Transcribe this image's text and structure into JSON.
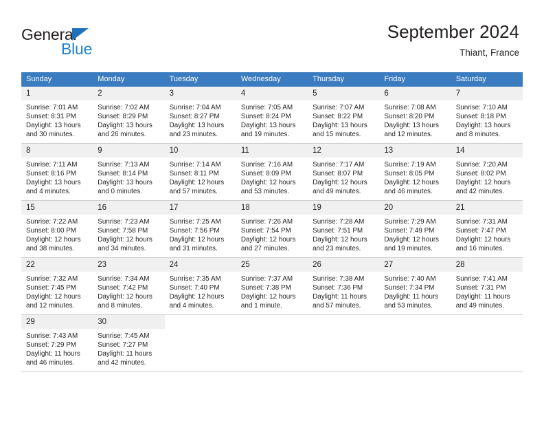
{
  "brand": {
    "name_dark": "General",
    "name_blue": "Blue",
    "accent_blue": "#2083c9",
    "triangle_blue": "#1d72bb"
  },
  "header": {
    "title": "September 2024",
    "subtitle": "Thiant, France",
    "header_bg": "#3b7cc0",
    "daynum_bg": "#f0f0f0"
  },
  "weekday_headers": [
    "Sunday",
    "Monday",
    "Tuesday",
    "Wednesday",
    "Thursday",
    "Friday",
    "Saturday"
  ],
  "weeks": [
    [
      {
        "day": "1",
        "sunrise": "Sunrise: 7:01 AM",
        "sunset": "Sunset: 8:31 PM",
        "daylight_1": "Daylight: 13 hours",
        "daylight_2": "and 30 minutes."
      },
      {
        "day": "2",
        "sunrise": "Sunrise: 7:02 AM",
        "sunset": "Sunset: 8:29 PM",
        "daylight_1": "Daylight: 13 hours",
        "daylight_2": "and 26 minutes."
      },
      {
        "day": "3",
        "sunrise": "Sunrise: 7:04 AM",
        "sunset": "Sunset: 8:27 PM",
        "daylight_1": "Daylight: 13 hours",
        "daylight_2": "and 23 minutes."
      },
      {
        "day": "4",
        "sunrise": "Sunrise: 7:05 AM",
        "sunset": "Sunset: 8:24 PM",
        "daylight_1": "Daylight: 13 hours",
        "daylight_2": "and 19 minutes."
      },
      {
        "day": "5",
        "sunrise": "Sunrise: 7:07 AM",
        "sunset": "Sunset: 8:22 PM",
        "daylight_1": "Daylight: 13 hours",
        "daylight_2": "and 15 minutes."
      },
      {
        "day": "6",
        "sunrise": "Sunrise: 7:08 AM",
        "sunset": "Sunset: 8:20 PM",
        "daylight_1": "Daylight: 13 hours",
        "daylight_2": "and 12 minutes."
      },
      {
        "day": "7",
        "sunrise": "Sunrise: 7:10 AM",
        "sunset": "Sunset: 8:18 PM",
        "daylight_1": "Daylight: 13 hours",
        "daylight_2": "and 8 minutes."
      }
    ],
    [
      {
        "day": "8",
        "sunrise": "Sunrise: 7:11 AM",
        "sunset": "Sunset: 8:16 PM",
        "daylight_1": "Daylight: 13 hours",
        "daylight_2": "and 4 minutes."
      },
      {
        "day": "9",
        "sunrise": "Sunrise: 7:13 AM",
        "sunset": "Sunset: 8:14 PM",
        "daylight_1": "Daylight: 13 hours",
        "daylight_2": "and 0 minutes."
      },
      {
        "day": "10",
        "sunrise": "Sunrise: 7:14 AM",
        "sunset": "Sunset: 8:11 PM",
        "daylight_1": "Daylight: 12 hours",
        "daylight_2": "and 57 minutes."
      },
      {
        "day": "11",
        "sunrise": "Sunrise: 7:16 AM",
        "sunset": "Sunset: 8:09 PM",
        "daylight_1": "Daylight: 12 hours",
        "daylight_2": "and 53 minutes."
      },
      {
        "day": "12",
        "sunrise": "Sunrise: 7:17 AM",
        "sunset": "Sunset: 8:07 PM",
        "daylight_1": "Daylight: 12 hours",
        "daylight_2": "and 49 minutes."
      },
      {
        "day": "13",
        "sunrise": "Sunrise: 7:19 AM",
        "sunset": "Sunset: 8:05 PM",
        "daylight_1": "Daylight: 12 hours",
        "daylight_2": "and 46 minutes."
      },
      {
        "day": "14",
        "sunrise": "Sunrise: 7:20 AM",
        "sunset": "Sunset: 8:02 PM",
        "daylight_1": "Daylight: 12 hours",
        "daylight_2": "and 42 minutes."
      }
    ],
    [
      {
        "day": "15",
        "sunrise": "Sunrise: 7:22 AM",
        "sunset": "Sunset: 8:00 PM",
        "daylight_1": "Daylight: 12 hours",
        "daylight_2": "and 38 minutes."
      },
      {
        "day": "16",
        "sunrise": "Sunrise: 7:23 AM",
        "sunset": "Sunset: 7:58 PM",
        "daylight_1": "Daylight: 12 hours",
        "daylight_2": "and 34 minutes."
      },
      {
        "day": "17",
        "sunrise": "Sunrise: 7:25 AM",
        "sunset": "Sunset: 7:56 PM",
        "daylight_1": "Daylight: 12 hours",
        "daylight_2": "and 31 minutes."
      },
      {
        "day": "18",
        "sunrise": "Sunrise: 7:26 AM",
        "sunset": "Sunset: 7:54 PM",
        "daylight_1": "Daylight: 12 hours",
        "daylight_2": "and 27 minutes."
      },
      {
        "day": "19",
        "sunrise": "Sunrise: 7:28 AM",
        "sunset": "Sunset: 7:51 PM",
        "daylight_1": "Daylight: 12 hours",
        "daylight_2": "and 23 minutes."
      },
      {
        "day": "20",
        "sunrise": "Sunrise: 7:29 AM",
        "sunset": "Sunset: 7:49 PM",
        "daylight_1": "Daylight: 12 hours",
        "daylight_2": "and 19 minutes."
      },
      {
        "day": "21",
        "sunrise": "Sunrise: 7:31 AM",
        "sunset": "Sunset: 7:47 PM",
        "daylight_1": "Daylight: 12 hours",
        "daylight_2": "and 16 minutes."
      }
    ],
    [
      {
        "day": "22",
        "sunrise": "Sunrise: 7:32 AM",
        "sunset": "Sunset: 7:45 PM",
        "daylight_1": "Daylight: 12 hours",
        "daylight_2": "and 12 minutes."
      },
      {
        "day": "23",
        "sunrise": "Sunrise: 7:34 AM",
        "sunset": "Sunset: 7:42 PM",
        "daylight_1": "Daylight: 12 hours",
        "daylight_2": "and 8 minutes."
      },
      {
        "day": "24",
        "sunrise": "Sunrise: 7:35 AM",
        "sunset": "Sunset: 7:40 PM",
        "daylight_1": "Daylight: 12 hours",
        "daylight_2": "and 4 minutes."
      },
      {
        "day": "25",
        "sunrise": "Sunrise: 7:37 AM",
        "sunset": "Sunset: 7:38 PM",
        "daylight_1": "Daylight: 12 hours",
        "daylight_2": "and 1 minute."
      },
      {
        "day": "26",
        "sunrise": "Sunrise: 7:38 AM",
        "sunset": "Sunset: 7:36 PM",
        "daylight_1": "Daylight: 11 hours",
        "daylight_2": "and 57 minutes."
      },
      {
        "day": "27",
        "sunrise": "Sunrise: 7:40 AM",
        "sunset": "Sunset: 7:34 PM",
        "daylight_1": "Daylight: 11 hours",
        "daylight_2": "and 53 minutes."
      },
      {
        "day": "28",
        "sunrise": "Sunrise: 7:41 AM",
        "sunset": "Sunset: 7:31 PM",
        "daylight_1": "Daylight: 11 hours",
        "daylight_2": "and 49 minutes."
      }
    ],
    [
      {
        "day": "29",
        "sunrise": "Sunrise: 7:43 AM",
        "sunset": "Sunset: 7:29 PM",
        "daylight_1": "Daylight: 11 hours",
        "daylight_2": "and 46 minutes."
      },
      {
        "day": "30",
        "sunrise": "Sunrise: 7:45 AM",
        "sunset": "Sunset: 7:27 PM",
        "daylight_1": "Daylight: 11 hours",
        "daylight_2": "and 42 minutes."
      },
      {
        "day": "",
        "sunrise": "",
        "sunset": "",
        "daylight_1": "",
        "daylight_2": ""
      },
      {
        "day": "",
        "sunrise": "",
        "sunset": "",
        "daylight_1": "",
        "daylight_2": ""
      },
      {
        "day": "",
        "sunrise": "",
        "sunset": "",
        "daylight_1": "",
        "daylight_2": ""
      },
      {
        "day": "",
        "sunrise": "",
        "sunset": "",
        "daylight_1": "",
        "daylight_2": ""
      },
      {
        "day": "",
        "sunrise": "",
        "sunset": "",
        "daylight_1": "",
        "daylight_2": ""
      }
    ]
  ]
}
